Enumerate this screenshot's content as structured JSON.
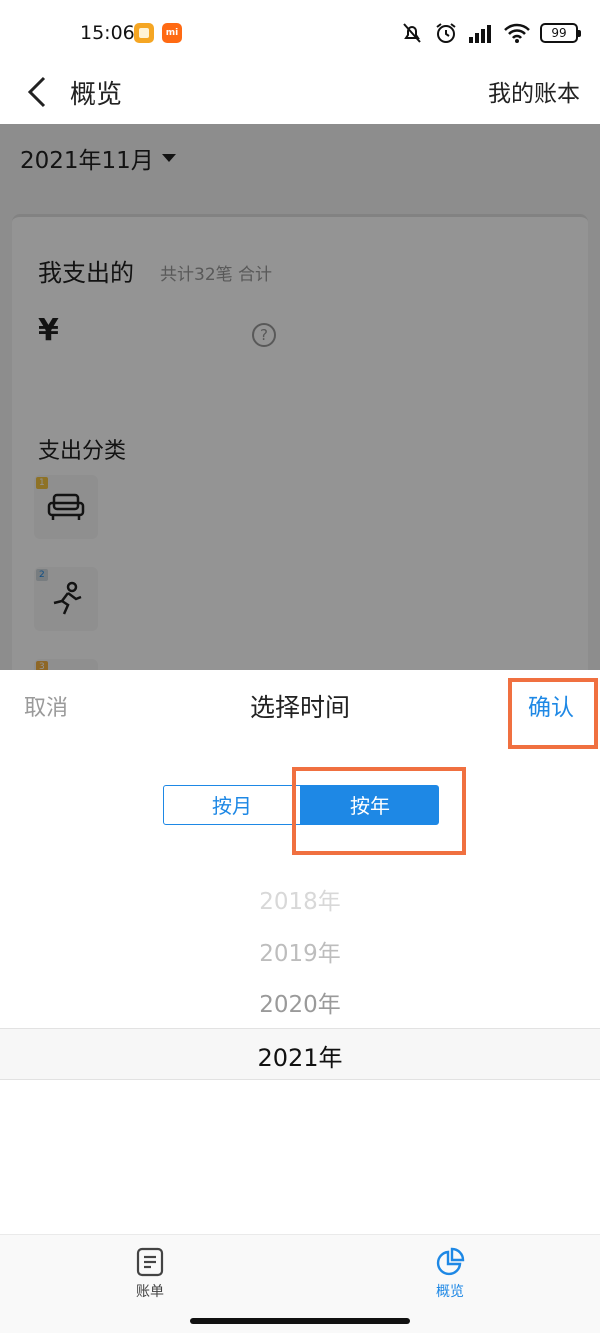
{
  "status_bar": {
    "time": "15:06",
    "app_badge": "mi",
    "battery": "99"
  },
  "nav": {
    "title": "概览",
    "right_action": "我的账本"
  },
  "background": {
    "month_selector": "2021年11月",
    "summary_title": "我支出的",
    "summary_subtitle": "共计32笔 合计",
    "currency_symbol": "¥",
    "help_glyph": "?",
    "category_section_title": "支出分类",
    "category_ranks": [
      "1",
      "2",
      "3"
    ]
  },
  "sheet": {
    "cancel_label": "取消",
    "title": "选择时间",
    "confirm_label": "确认",
    "mode_month_label": "按月",
    "mode_year_label": "按年",
    "selected_mode": "按年",
    "years": [
      "2018年",
      "2019年",
      "2020年",
      "2021年"
    ],
    "selected_year": "2021年"
  },
  "tabbar": {
    "tabs": [
      {
        "label": "账单",
        "active": false
      },
      {
        "label": "概览",
        "active": true
      }
    ]
  },
  "colors": {
    "accent": "#1e88e5",
    "highlight": "#f07040"
  }
}
